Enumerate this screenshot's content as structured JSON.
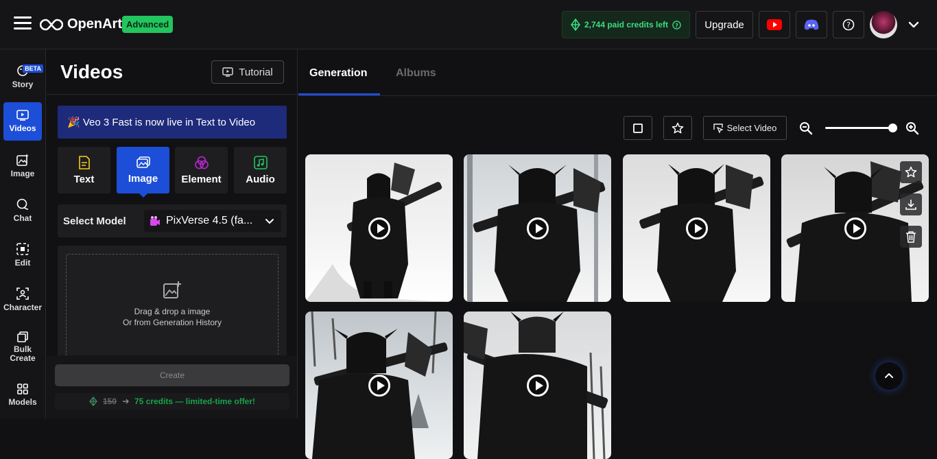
{
  "header": {
    "brand": "OpenArt",
    "plan_badge": "Advanced",
    "credits": "2,744 paid credits left",
    "upgrade_label": "Upgrade"
  },
  "rail": {
    "items": [
      {
        "label": "Story",
        "badge": "BETA"
      },
      {
        "label": "Videos"
      },
      {
        "label": "Image"
      },
      {
        "label": "Chat"
      },
      {
        "label": "Edit"
      },
      {
        "label": "Character"
      },
      {
        "label": "Bulk Create"
      },
      {
        "label": "Models"
      }
    ]
  },
  "panel": {
    "title": "Videos",
    "tutorial_label": "Tutorial",
    "banner": "🎉 Veo 3 Fast is now live in Text to Video",
    "modes": [
      {
        "label": "Text"
      },
      {
        "label": "Image"
      },
      {
        "label": "Element"
      },
      {
        "label": "Audio"
      }
    ],
    "select_model_label": "Select Model",
    "model_value": "PixVerse 4.5 (fa...",
    "drop_line1": "Drag & drop a image",
    "drop_line2": "Or from Generation History",
    "create_label": "Create",
    "offer_old": "150",
    "offer_new": "75 credits — limited-time offer!"
  },
  "main": {
    "tabs": [
      {
        "label": "Generation"
      },
      {
        "label": "Albums"
      }
    ],
    "select_video_label": "Select Video"
  },
  "colors": {
    "accent": "#1d4ed8",
    "success": "#22c55e",
    "banner": "#1e2a7a"
  }
}
